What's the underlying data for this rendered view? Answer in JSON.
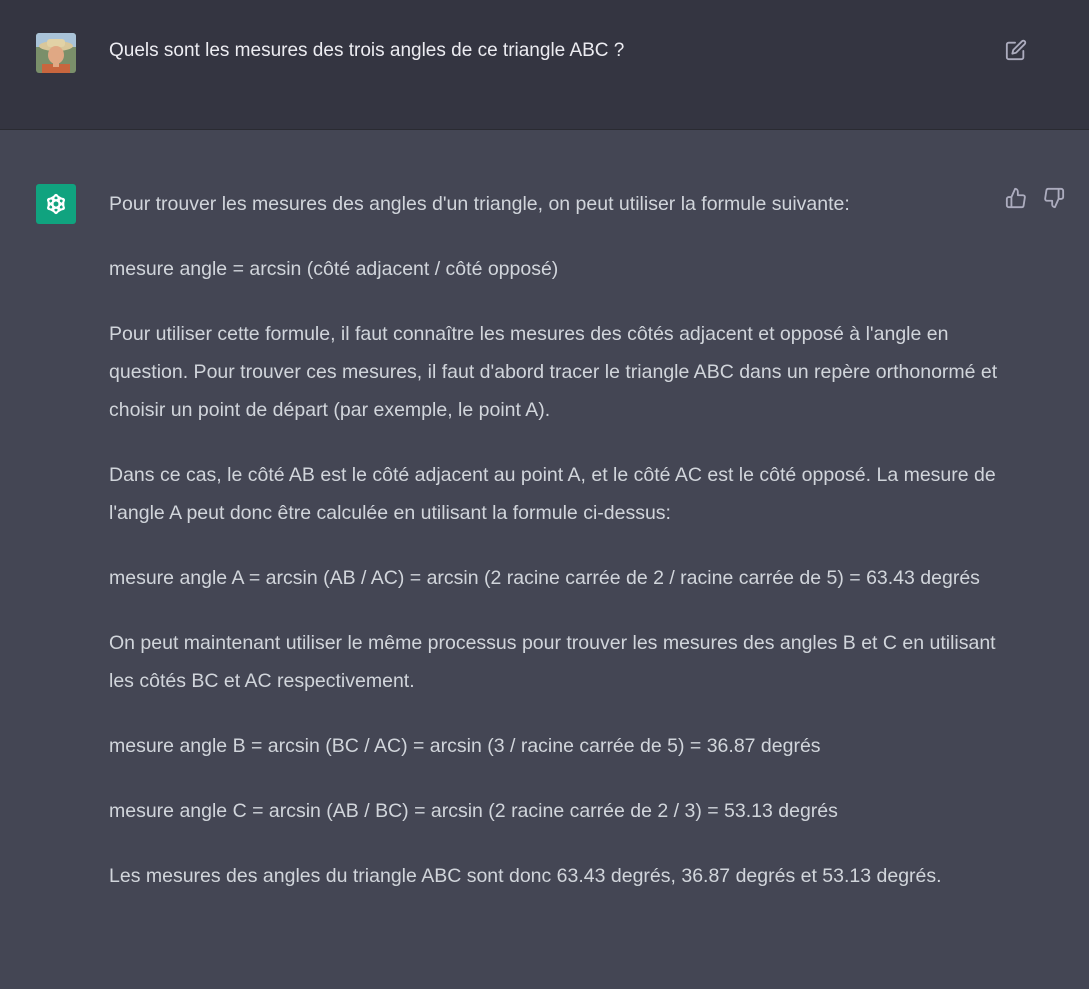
{
  "user_message": {
    "text": "Quels sont les mesures des trois angles de ce triangle ABC ?",
    "avatar_icon": "user-avatar-photo",
    "edit_icon": "edit-icon"
  },
  "assistant_message": {
    "avatar_icon": "openai-logo-icon",
    "feedback": {
      "thumbs_up_icon": "thumbs-up-icon",
      "thumbs_down_icon": "thumbs-down-icon"
    },
    "paragraphs": [
      "Pour trouver les mesures des angles d'un triangle, on peut utiliser la formule suivante:",
      "mesure angle = arcsin (côté adjacent / côté opposé)",
      "Pour utiliser cette formule, il faut connaître les mesures des côtés adjacent et opposé à l'angle en question. Pour trouver ces mesures, il faut d'abord tracer le triangle ABC dans un repère orthonormé et choisir un point de départ (par exemple, le point A).",
      "Dans ce cas, le côté AB est le côté adjacent au point A, et le côté AC est le côté opposé. La mesure de l'angle A peut donc être calculée en utilisant la formule ci-dessus:",
      "mesure angle A = arcsin (AB / AC) = arcsin (2 racine carrée de 2 / racine carrée de 5) = 63.43 degrés",
      "On peut maintenant utiliser le même processus pour trouver les mesures des angles B et C en utilisant les côtés BC et AC respectivement.",
      "mesure angle B = arcsin (BC / AC) = arcsin (3 / racine carrée de 5) = 36.87 degrés",
      "mesure angle C = arcsin (AB / BC) = arcsin (2 racine carrée de 2 / 3) = 53.13 degrés",
      "Les mesures des angles du triangle ABC sont donc 63.43 degrés, 36.87 degrés et 53.13 degrés."
    ]
  },
  "colors": {
    "user_bg": "#343541",
    "assistant_bg": "#444654",
    "accent": "#10a37f"
  }
}
